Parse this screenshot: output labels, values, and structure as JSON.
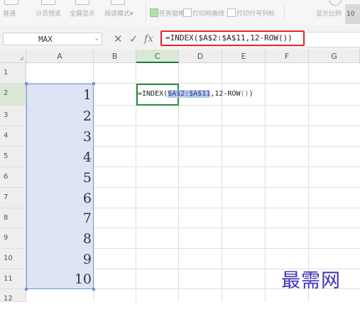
{
  "ribbon": {
    "items": [
      {
        "label": "普通"
      },
      {
        "label": "分页预览"
      },
      {
        "label": "全屏显示"
      },
      {
        "label": "阅读模式"
      }
    ],
    "arrow": "▾",
    "checks": [
      {
        "label": "任务窗格",
        "checked": true
      },
      {
        "label": "打印网格线",
        "checked": false
      },
      {
        "label": "打印行号列标",
        "checked": false
      }
    ],
    "zoom_label": "显示比例",
    "zoom_value": "10"
  },
  "formula_bar": {
    "name_box": "MAX",
    "dropdown_arrow": "⌄",
    "cancel_icon": "✕",
    "confirm_icon": "✓",
    "fx_label": "fx",
    "formula": "=INDEX($A$2:$A$11,12-ROW())"
  },
  "columns": [
    "A",
    "B",
    "C",
    "D",
    "E",
    "F",
    "G"
  ],
  "rows": [
    "1",
    "2",
    "3",
    "4",
    "5",
    "6",
    "7",
    "8",
    "9",
    "10",
    "11",
    "12"
  ],
  "column_a_values": [
    "1",
    "2",
    "3",
    "4",
    "5",
    "6",
    "7",
    "8",
    "9",
    "10"
  ],
  "cell_formula": {
    "prefix": "=INDEX(",
    "range_ref": "$A$2:$A$11",
    "middle": ",12-ROW",
    "parens": "()",
    "suffix": ")"
  },
  "watermark": "最需网",
  "colors": {
    "accent_green": "#217346",
    "selection_blue": "#dde4f3",
    "highlight_border": "#e02727",
    "watermark": "#3b33b8"
  }
}
